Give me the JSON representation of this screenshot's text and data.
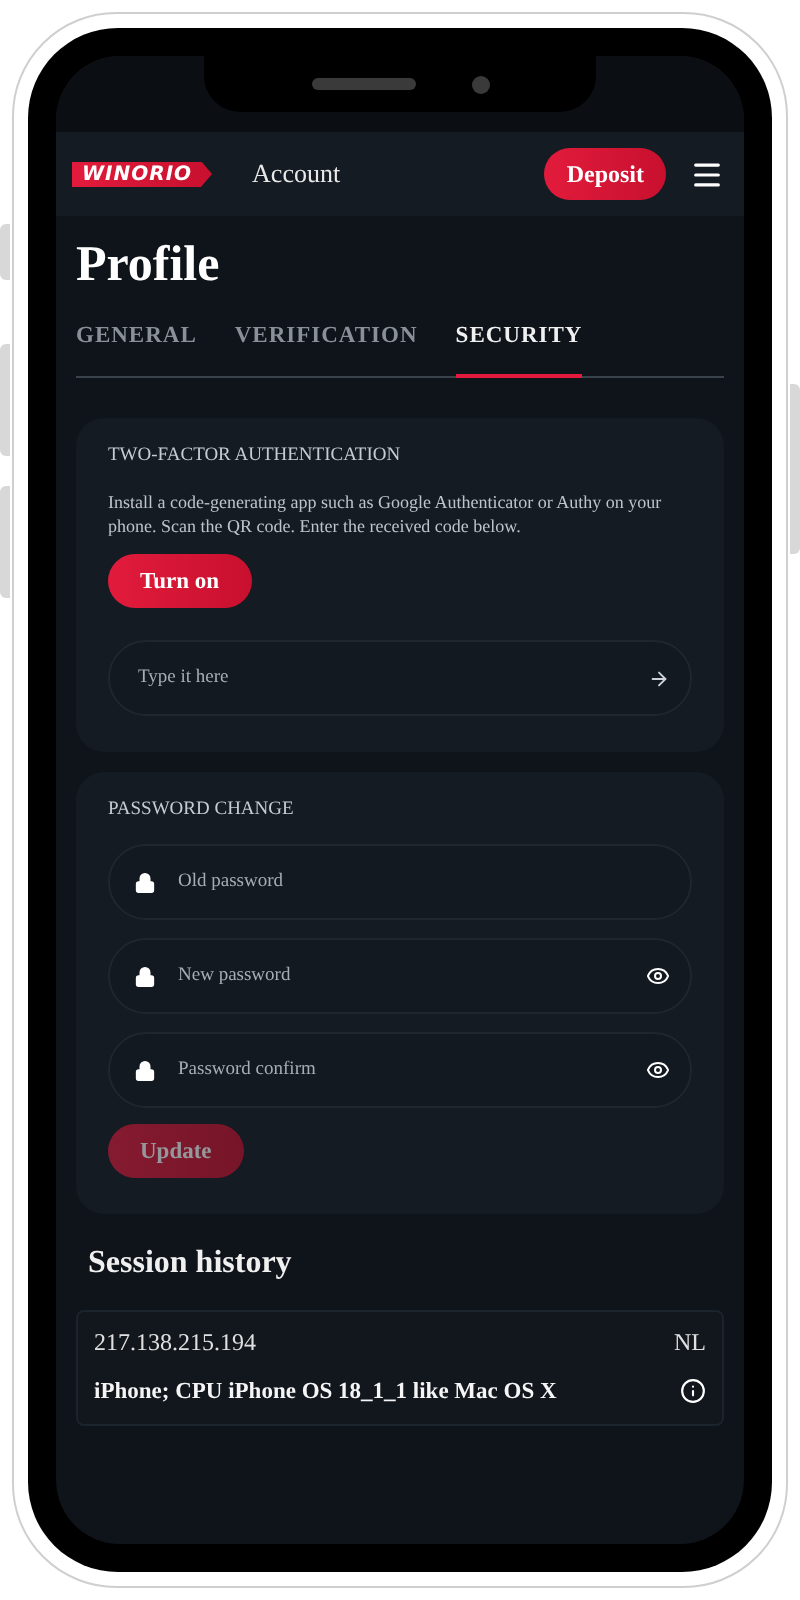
{
  "header": {
    "logo": "WINORIO",
    "title": "Account",
    "deposit": "Deposit"
  },
  "page_title": "Profile",
  "tabs": [
    {
      "label": "GENERAL",
      "selected": false
    },
    {
      "label": "VERIFICATION",
      "selected": false
    },
    {
      "label": "SECURITY",
      "selected": true
    }
  ],
  "two_factor": {
    "title": "TWO-FACTOR AUTHENTICATION",
    "description": "Install a code-generating app such as Google Authenticator or Authy on your phone. Scan the QR code. Enter the received code below.",
    "button": "Turn on",
    "code_field": {
      "placeholder": "Type it here"
    }
  },
  "password_change": {
    "title": "PASSWORD CHANGE",
    "fields": [
      {
        "placeholder": "Old password",
        "reveal": false
      },
      {
        "placeholder": "New password",
        "reveal": true
      },
      {
        "placeholder": "Password confirm",
        "reveal": true
      }
    ],
    "button": {
      "label": "Update",
      "disabled": true
    }
  },
  "session_history": {
    "title": "Session history",
    "items": [
      {
        "ip": "217.138.215.194",
        "country": "NL",
        "device": "iPhone; CPU iPhone OS 18_1_1 like Mac OS X"
      }
    ]
  }
}
